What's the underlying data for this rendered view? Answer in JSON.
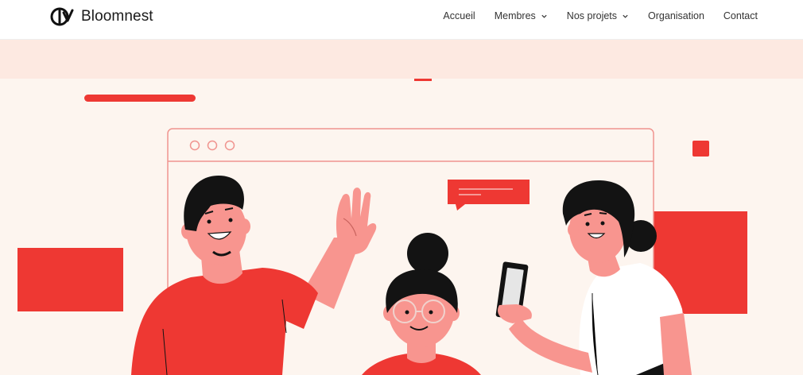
{
  "site": {
    "brand_name": "Bloomnest",
    "logo_icon": "bloomnest-logo-icon"
  },
  "nav": {
    "items": [
      {
        "label": "Accueil",
        "dropdown": false
      },
      {
        "label": "Membres",
        "dropdown": true
      },
      {
        "label": "Nos projets",
        "dropdown": true
      },
      {
        "label": "Organisation",
        "dropdown": false
      },
      {
        "label": "Contact",
        "dropdown": false
      }
    ]
  },
  "theme": {
    "accent": "#ee3833",
    "band": "#fde9e1",
    "hero_bg": "#fdf5ef",
    "skin": "#f8958f",
    "hair": "#131313"
  }
}
